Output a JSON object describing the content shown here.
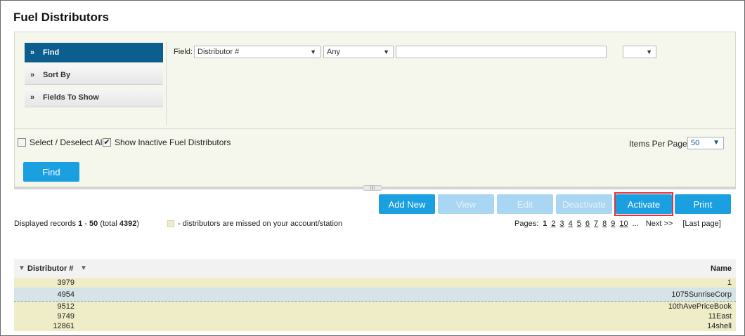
{
  "page": {
    "title": "Fuel Distributors"
  },
  "side_menu": [
    {
      "label": "Find",
      "active": true
    },
    {
      "label": "Sort By",
      "active": false
    },
    {
      "label": "Fields To Show",
      "active": false
    }
  ],
  "find": {
    "field_label": "Field:",
    "field_select": "Distributor #",
    "operator_select": "Any",
    "value": "",
    "extra_select": ""
  },
  "options": {
    "select_all_label": "Select / Deselect All",
    "select_all_checked": false,
    "show_inactive_label": "Show Inactive Fuel Distributors",
    "show_inactive_checked": true,
    "items_per_page_label": "Items Per Page",
    "items_per_page": "50"
  },
  "buttons": {
    "find": "Find",
    "add_new": "Add New",
    "view": "View",
    "edit": "Edit",
    "deactivate": "Deactivate",
    "activate": "Activate",
    "print": "Print"
  },
  "records": {
    "prefix": "Displayed records",
    "from": "1",
    "to": "50",
    "total": "4392"
  },
  "legend_text": "- distributors are missed on your account/station",
  "pager": {
    "label": "Pages:",
    "pages": [
      "1",
      "2",
      "3",
      "4",
      "5",
      "6",
      "7",
      "8",
      "9",
      "10"
    ],
    "current": "1",
    "ellipsis": "...",
    "next": "Next >>",
    "last": "[Last page]"
  },
  "table": {
    "columns": {
      "distributor": "Distributor #",
      "name": "Name"
    },
    "rows": [
      {
        "num": "3979",
        "name": "1"
      },
      {
        "num": "4954",
        "name": "1075SunriseCorp"
      },
      {
        "num": "9512",
        "name": "10thAvePriceBook"
      },
      {
        "num": "9749",
        "name": "11East"
      },
      {
        "num": "12861",
        "name": "14shell"
      }
    ]
  },
  "colors": {
    "accent": "#1a9fe0",
    "active_menu": "#0b5e8d",
    "highlight": "#e2333a",
    "missed_row": "#efedc8"
  }
}
